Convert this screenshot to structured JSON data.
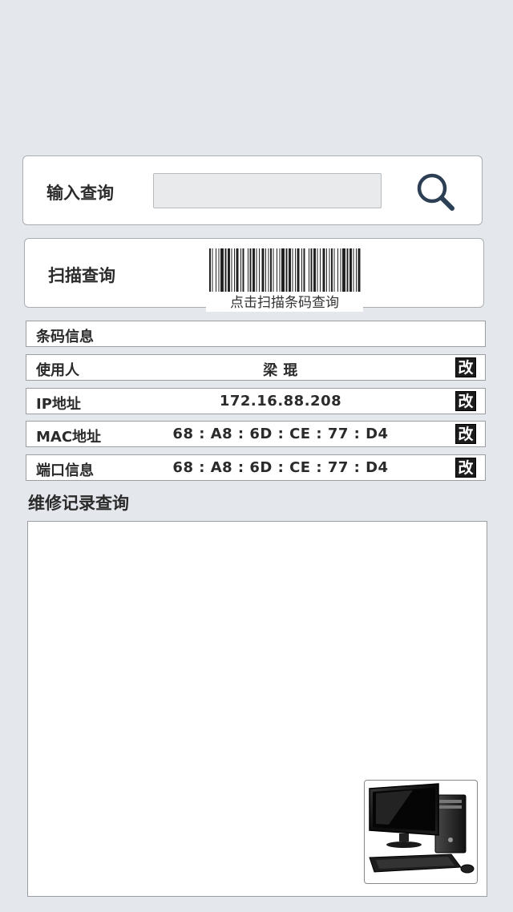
{
  "search": {
    "label": "输入查询",
    "value": "",
    "placeholder": ""
  },
  "scan": {
    "label": "扫描查询",
    "barcode_caption": "点击扫描条码查询"
  },
  "barcode_info": {
    "label": "条码信息"
  },
  "rows": [
    {
      "label": "使用人",
      "value": "梁 琨",
      "edit_label": "改"
    },
    {
      "label": "IP地址",
      "value": "172.16.88.208",
      "edit_label": "改"
    },
    {
      "label": "MAC地址",
      "value": "68 : A8 : 6D : CE : 77 : D4",
      "edit_label": "改"
    },
    {
      "label": "端口信息",
      "value": "68 : A8 : 6D : CE : 77 : D4",
      "edit_label": "改"
    }
  ],
  "records": {
    "title": "维修记录查询"
  },
  "icons": {
    "search": "search-icon",
    "barcode": "barcode-icon",
    "computer": "computer-icon"
  },
  "colors": {
    "background": "#e4e7eb",
    "search_icon": "#2d3f55",
    "edit_button": "#1c1c1c"
  }
}
